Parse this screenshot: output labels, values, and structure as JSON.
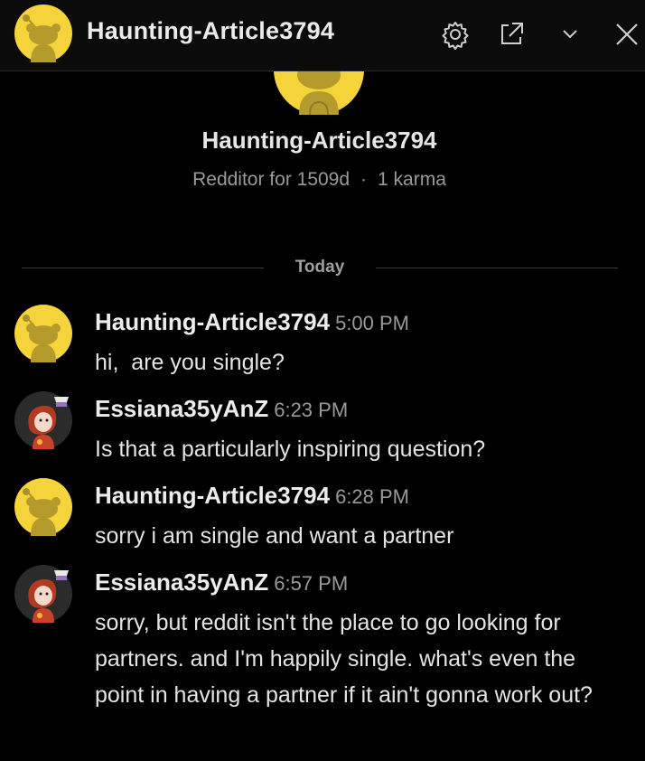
{
  "header": {
    "title": "Haunting-Article3794",
    "icons": [
      "snoo-avatar",
      "gear-icon",
      "external-link-icon",
      "chevron-down-icon",
      "close-icon"
    ]
  },
  "profile": {
    "name": "Haunting-Article3794",
    "age": "Redditor for 1509d",
    "separator": "·",
    "karma": "1 karma"
  },
  "divider": {
    "label": "Today"
  },
  "messages": [
    {
      "author": "Haunting-Article3794",
      "time": "5:00 PM",
      "text": "hi,  are you single?",
      "avatar": "snoo"
    },
    {
      "author": "Essiana35yAnZ",
      "time": "6:23 PM",
      "text": "Is that a particularly inspiring question?",
      "avatar": "character"
    },
    {
      "author": "Haunting-Article3794",
      "time": "6:28 PM",
      "text": "sorry i am single and want a partner",
      "avatar": "snoo"
    },
    {
      "author": "Essiana35yAnZ",
      "time": "6:57 PM",
      "text": "sorry, but reddit isn't the place to go looking for partners. and I'm happily single. what's even the point in having a partner if it ain't gonna work out?",
      "avatar": "character"
    }
  ],
  "colors": {
    "background": "#000000",
    "header_bg": "#0b0b0b",
    "snoo_avatar_bg": "#f5d33b",
    "snoo_body": "#b59a2c",
    "meta_text": "#9a9a9a"
  }
}
